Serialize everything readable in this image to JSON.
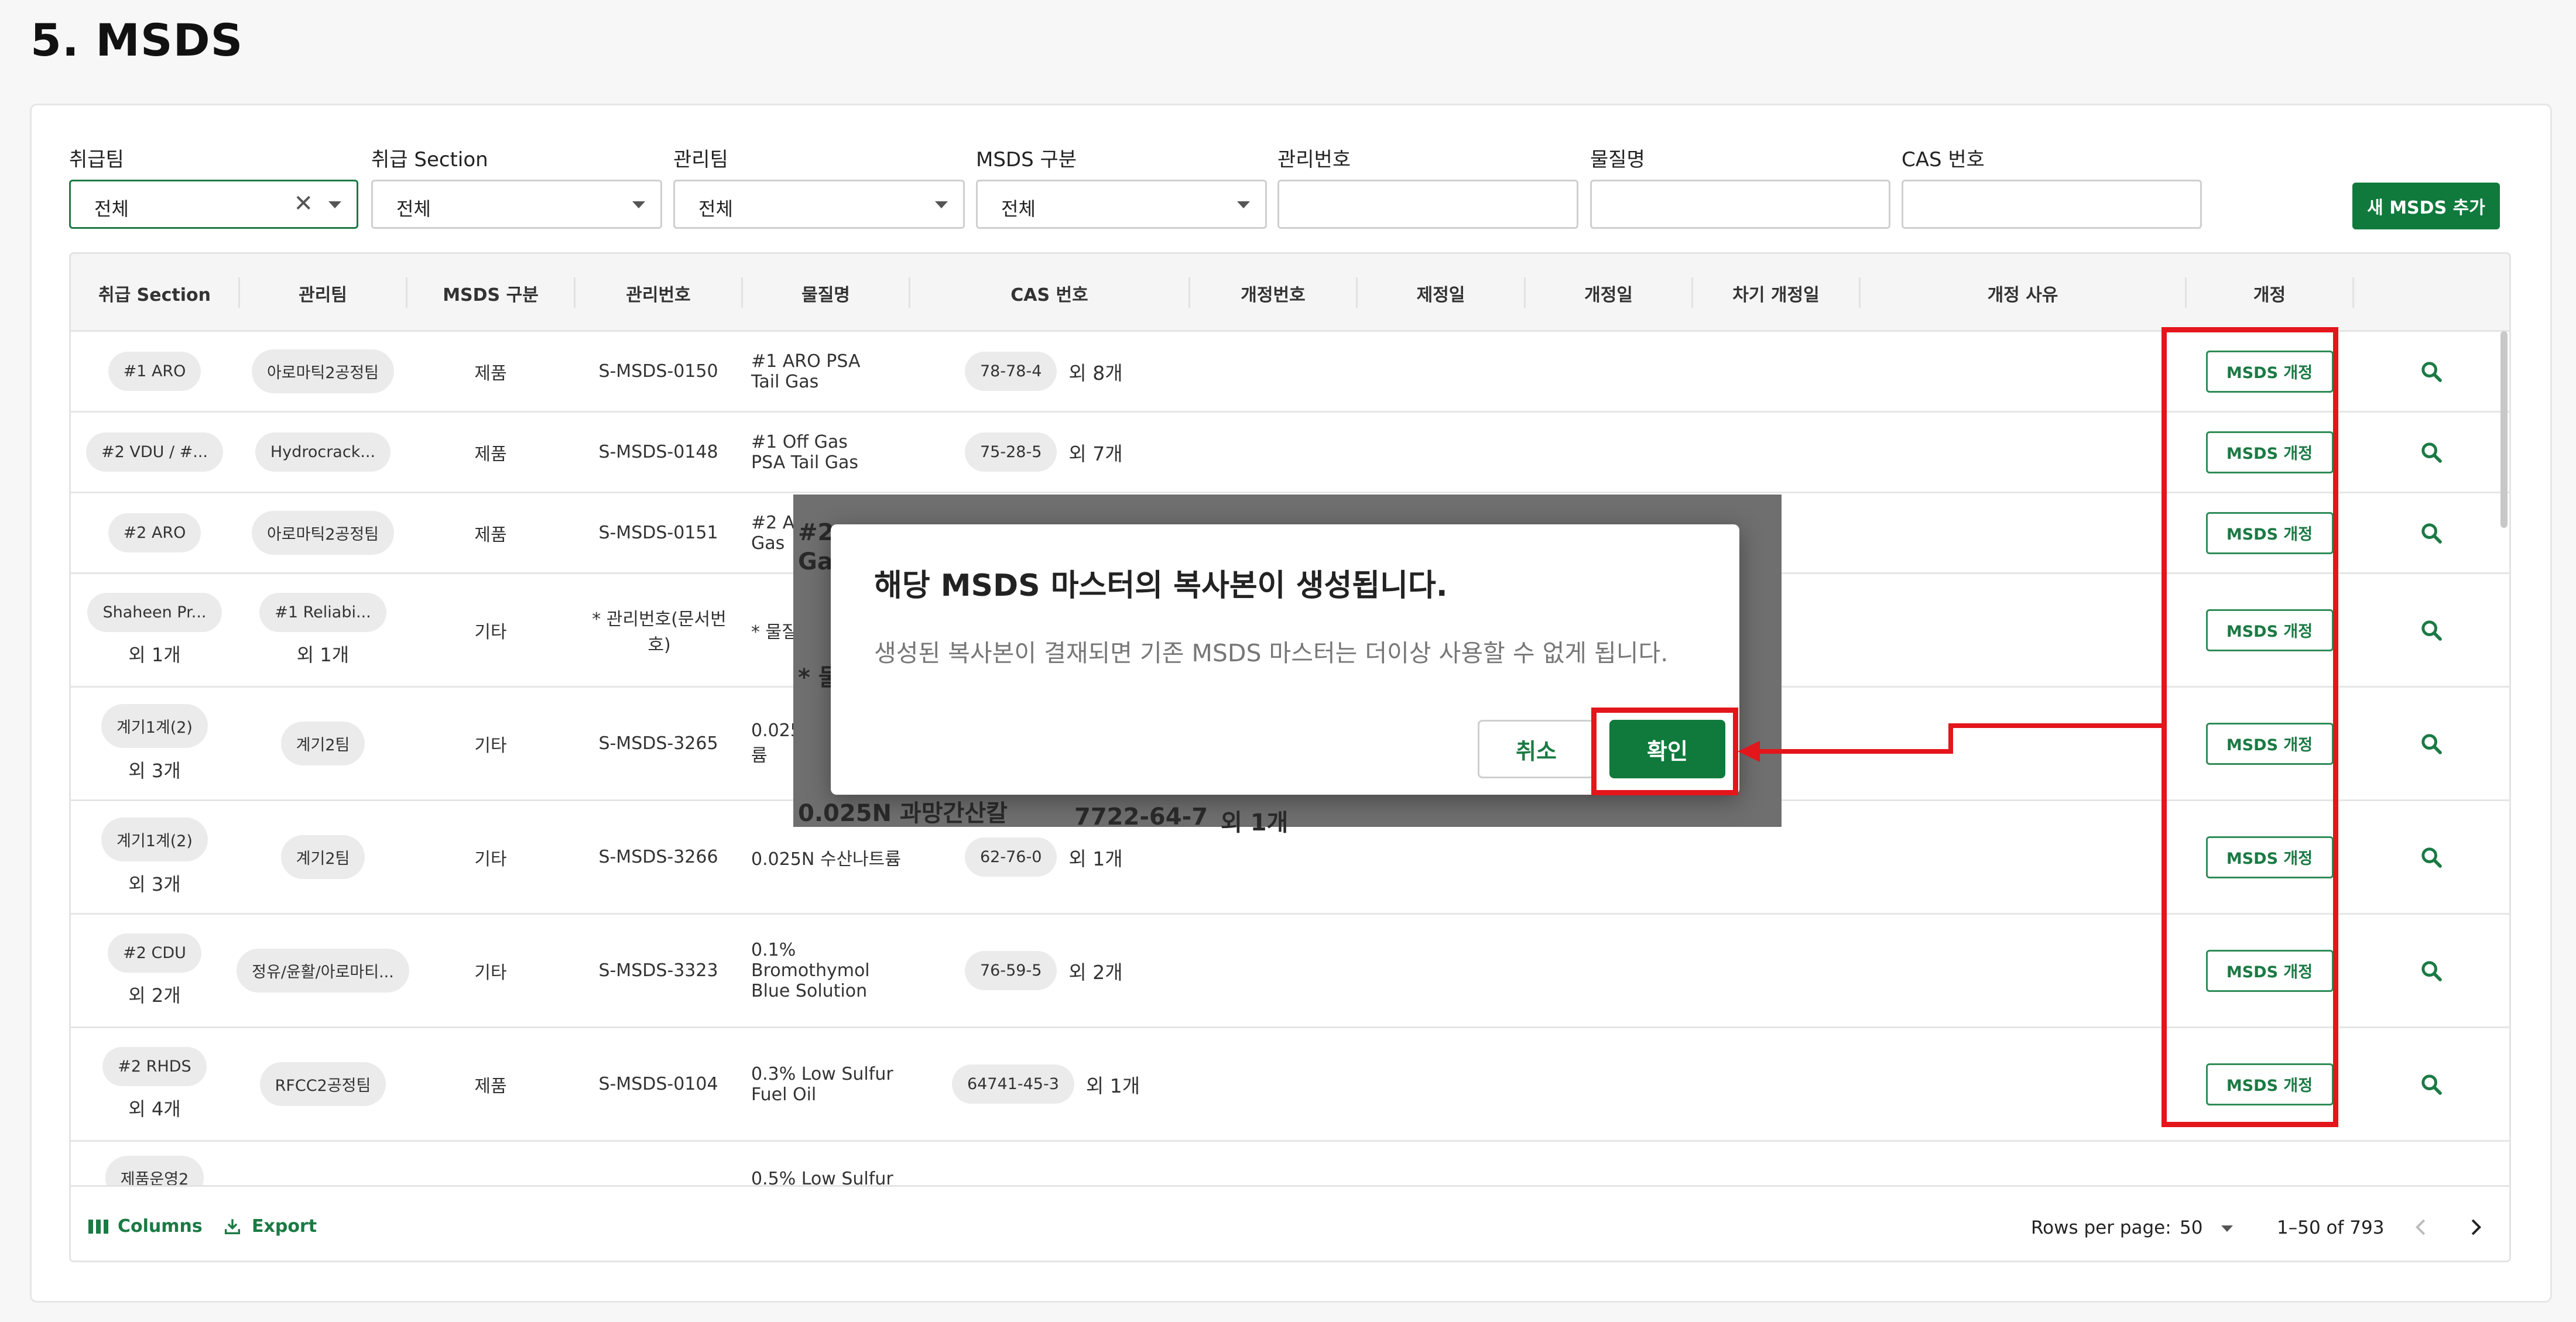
{
  "page": {
    "title": "5. MSDS"
  },
  "filters": [
    {
      "label": "취급팀",
      "value": "전체",
      "type": "select",
      "clearable": true
    },
    {
      "label": "취급 Section",
      "value": "전체",
      "type": "select"
    },
    {
      "label": "관리팀",
      "value": "전체",
      "type": "select"
    },
    {
      "label": "MSDS 구분",
      "value": "전체",
      "type": "select"
    },
    {
      "label": "관리번호",
      "value": "",
      "type": "text"
    },
    {
      "label": "물질명",
      "value": "",
      "type": "text"
    },
    {
      "label": "CAS 번호",
      "value": "",
      "type": "text"
    }
  ],
  "add_button": "새 MSDS 추가",
  "table": {
    "columns": [
      "취급 Section",
      "관리팀",
      "MSDS 구분",
      "관리번호",
      "물질명",
      "CAS 번호",
      "개정번호",
      "제정일",
      "개정일",
      "차기 개정일",
      "개정 사유",
      "개정"
    ],
    "revise_label": "MSDS 개정",
    "rows": [
      {
        "section": "#1 ARO",
        "section_more": "",
        "team": "아로마틱2공정팀",
        "team_more": "",
        "type": "제품",
        "no": "S-MSDS-0150",
        "name": "#1 ARO PSA Tail Gas",
        "cas": "78-78-4",
        "cas_more": "외 8개"
      },
      {
        "section": "#2 VDU / #...",
        "section_more": "",
        "team": "Hydrocrack...",
        "team_more": "",
        "type": "제품",
        "no": "S-MSDS-0148",
        "name": "#1 Off Gas PSA Tail Gas",
        "cas": "75-28-5",
        "cas_more": "외 7개"
      },
      {
        "section": "#2 ARO",
        "section_more": "",
        "team": "아로마틱2공정팀",
        "team_more": "",
        "type": "제품",
        "no": "S-MSDS-0151",
        "name": "#2 AR Gas",
        "cas": "",
        "cas_more": ""
      },
      {
        "section": "Shaheen Pr...",
        "section_more": "외 1개",
        "team": "#1 Reliabi...",
        "team_more": "외 1개",
        "type": "기타",
        "no": "* 관리번호(문서번호)",
        "name": "* 물질",
        "cas": "",
        "cas_more": ""
      },
      {
        "section": "계기1계(2)",
        "section_more": "외 3개",
        "team": "계기2팀",
        "team_more": "",
        "type": "기타",
        "no": "S-MSDS-3265",
        "name": "0.025 륨",
        "cas": "",
        "cas_more": ""
      },
      {
        "section": "계기1계(2)",
        "section_more": "외 3개",
        "team": "계기2팀",
        "team_more": "",
        "type": "기타",
        "no": "S-MSDS-3266",
        "name": "0.025N 수산나트륨",
        "cas": "62-76-0",
        "cas_more": "외 1개"
      },
      {
        "section": "#2 CDU",
        "section_more": "외 2개",
        "team": "정유/윤활/아로마티...",
        "team_more": "",
        "type": "기타",
        "no": "S-MSDS-3323",
        "name": "0.1% Bromothymol Blue Solution",
        "cas": "76-59-5",
        "cas_more": "외 2개"
      },
      {
        "section": "#2 RHDS",
        "section_more": "외 4개",
        "team": "RFCC2공정팀",
        "team_more": "",
        "type": "제품",
        "no": "S-MSDS-0104",
        "name": "0.3% Low Sulfur Fuel Oil",
        "cas": "64741-45-3",
        "cas_more": "외 1개"
      },
      {
        "section": "제품운영2",
        "section_more": "",
        "team": "",
        "team_more": "",
        "type": "",
        "no": "",
        "name": "0.5% Low Sulfur",
        "cas": "",
        "cas_more": ""
      }
    ]
  },
  "footer": {
    "columns_label": "Columns",
    "export_label": "Export",
    "rows_per_page_label": "Rows per page:",
    "rows_per_page_value": "50",
    "range": "1–50 of 793"
  },
  "background_ghost": {
    "a": "#2",
    "b": "Gas",
    "c": "* 물",
    "d": "0.025N 과망간산칼",
    "e": "7722-64-7",
    "f": "외 1개"
  },
  "dialog": {
    "title": "해당 MSDS 마스터의 복사본이 생성됩니다.",
    "body": "생성된 복사본이 결재되면 기존 MSDS 마스터는 더이상 사용할 수 없게 됩니다.",
    "cancel": "취소",
    "confirm": "확인"
  },
  "colors": {
    "accent": "#0f7a3c",
    "annotation": "#e3161b"
  },
  "icons": {
    "search": "search-icon",
    "columns": "columns-icon",
    "export": "export-icon"
  }
}
